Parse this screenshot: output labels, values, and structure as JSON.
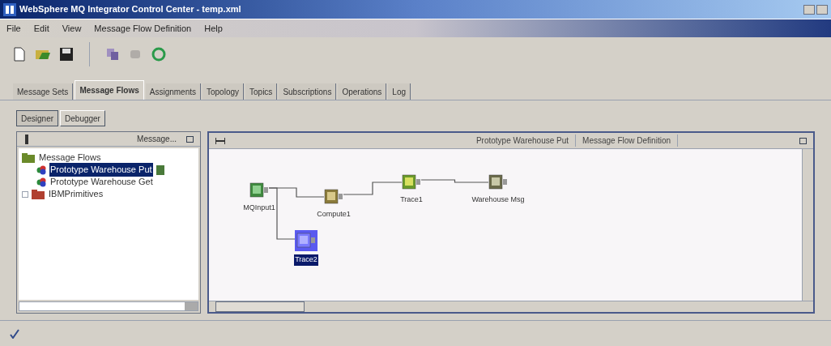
{
  "window": {
    "title": "WebSphere MQ Integrator Control Center - temp.xml"
  },
  "menu": [
    "File",
    "Edit",
    "View",
    "Message Flow Definition",
    "Help"
  ],
  "tabs": [
    {
      "label": "Message Sets",
      "selected": false
    },
    {
      "label": "Message Flows",
      "selected": true
    },
    {
      "label": "Assignments",
      "selected": false
    },
    {
      "label": "Topology",
      "selected": false
    },
    {
      "label": "Topics",
      "selected": false
    },
    {
      "label": "Subscriptions",
      "selected": false
    },
    {
      "label": "Operations",
      "selected": false
    },
    {
      "label": "Log",
      "selected": false
    }
  ],
  "subtabs": [
    {
      "label": "Designer",
      "selected": true
    },
    {
      "label": "Debugger",
      "selected": false
    }
  ],
  "tree_panel": {
    "header": "Message...",
    "items": [
      {
        "label": "Message Flows",
        "kind": "folder",
        "selected": false,
        "children": [
          {
            "label": "Prototype Warehouse Put",
            "kind": "flow",
            "selected": true
          },
          {
            "label": "Prototype Warehouse Get",
            "kind": "flow",
            "selected": false
          }
        ]
      },
      {
        "label": "IBMPrimitives",
        "kind": "primitives",
        "selected": false
      }
    ]
  },
  "canvas": {
    "tabs": [
      "Prototype Warehouse Put",
      "Message Flow Definition"
    ],
    "nodes": [
      {
        "label": "MQInput1",
        "kind": "input",
        "selected": false
      },
      {
        "label": "Compute1",
        "kind": "compute",
        "selected": false
      },
      {
        "label": "Trace1",
        "kind": "trace",
        "selected": false
      },
      {
        "label": "Warehouse Msg",
        "kind": "output",
        "selected": false
      },
      {
        "label": "Trace2",
        "kind": "trace",
        "selected": true
      }
    ]
  }
}
